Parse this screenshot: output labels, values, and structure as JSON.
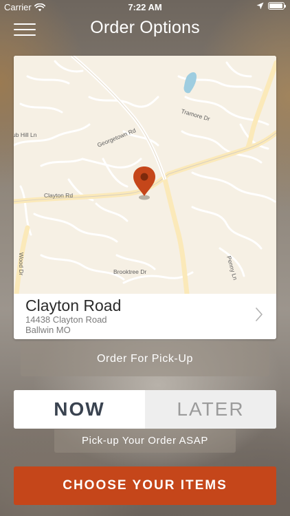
{
  "status_bar": {
    "carrier": "Carrier",
    "time": "7:22 AM",
    "battery_level": 0.95
  },
  "header": {
    "title": "Order Options",
    "menu_icon": "hamburger-menu-icon"
  },
  "map": {
    "labels": {
      "georgetown": "Georgetown Rd",
      "tramore": "Tramore Dr",
      "hill": "ub Hill Ln",
      "clayton": "Clayton Rd",
      "brooktree": "Brooktree Dr",
      "penny": "Penny Ln",
      "wood": "Wood Dr"
    },
    "pin_icon": "location-pin-icon",
    "pin_color": "#c5461a"
  },
  "store": {
    "name": "Clayton Road",
    "address_line1": "14438 Clayton Road",
    "address_line2": "Ballwin MO",
    "chevron_icon": "chevron-right-icon"
  },
  "order_type": {
    "label": "Order For Pick-Up"
  },
  "timing": {
    "options": [
      "NOW",
      "LATER"
    ],
    "selected": "NOW",
    "note": "Pick-up Your Order ASAP"
  },
  "cta": {
    "label": "CHOOSE YOUR ITEMS",
    "color": "#c5461a"
  }
}
